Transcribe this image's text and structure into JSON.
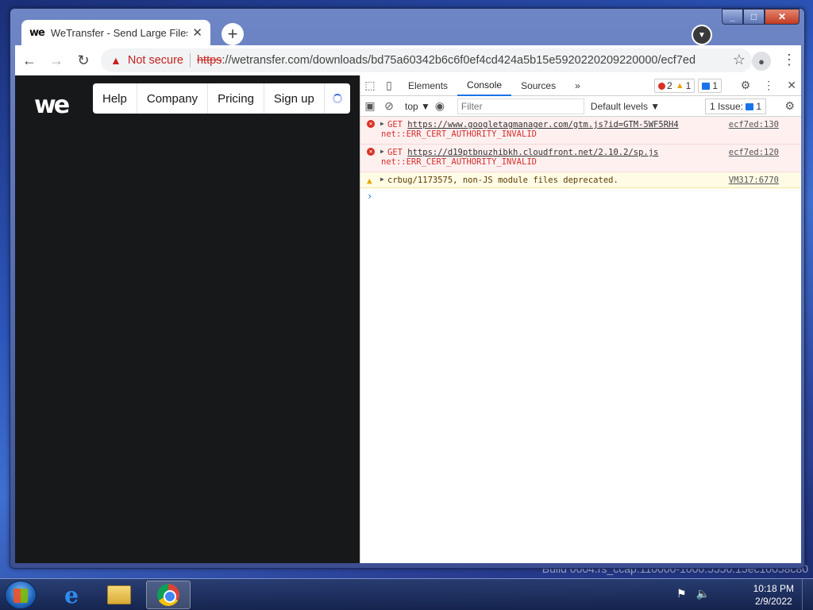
{
  "desktop": {
    "build_text": "Build 0004.rs_ccap.110000-1000.5550.15ec10058c80"
  },
  "browser": {
    "tab": {
      "favicon": "we",
      "title": "WeTransfer - Send Large Files &",
      "close": "✕"
    },
    "new_tab": "+",
    "nav": {
      "back": "←",
      "forward": "→",
      "reload": "↻"
    },
    "omnibox": {
      "security_label": "Not secure",
      "url_scheme": "https",
      "url_rest": "://wetransfer.com/downloads/bd75a60342b6c6f0ef4cd424a5b15e5920220209220000/ecf7ed"
    },
    "bookmark_icon": "star-icon",
    "account_icon": "account-icon",
    "menu_icon": "more-vert-icon"
  },
  "page": {
    "logo": "we",
    "nav": [
      "Help",
      "Company",
      "Pricing",
      "Sign up"
    ]
  },
  "devtools": {
    "tabs": [
      "Elements",
      "Console",
      "Sources"
    ],
    "active_tab": "Console",
    "more_tabs": "»",
    "badges": {
      "errors": "2",
      "warnings": "1",
      "messages": "1"
    },
    "console_bar": {
      "context": "top",
      "filter_placeholder": "Filter",
      "levels": "Default levels",
      "issues_label": "1 Issue:",
      "issues_count": "1"
    },
    "messages": [
      {
        "level": "error",
        "method": "GET",
        "url": "https://www.googletagmanager.com/gtm.js?id=GTM-5WF5RH4",
        "detail": "net::ERR_CERT_AUTHORITY_INVALID",
        "source": "ecf7ed:130"
      },
      {
        "level": "error",
        "method": "GET",
        "url": "https://d19ptbnuzhibkh.cloudfront.net/2.10.2/sp.js",
        "detail": "net::ERR_CERT_AUTHORITY_INVALID",
        "source": "ecf7ed:120"
      },
      {
        "level": "warning",
        "text": "crbug/1173575, non-JS module files deprecated.",
        "source": "VM317:6770"
      }
    ],
    "prompt": "›"
  },
  "taskbar": {
    "apps": [
      "internet-explorer",
      "file-explorer",
      "chrome"
    ],
    "time": "10:18 PM",
    "date": "2/9/2022"
  }
}
